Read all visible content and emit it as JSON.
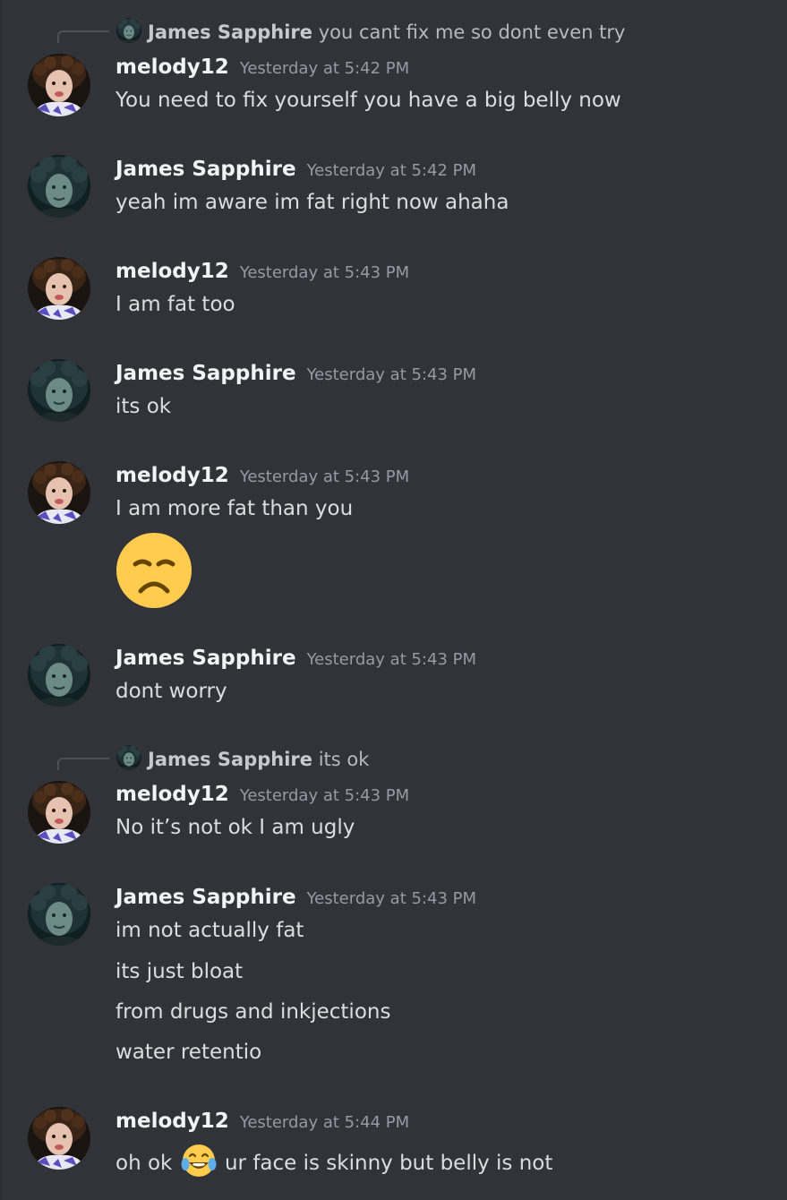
{
  "users": {
    "melody": "melody12",
    "james": "James Sapphire"
  },
  "messages": [
    {
      "reply": {
        "author": "James Sapphire",
        "content": "you cant fix me so dont even try"
      },
      "author": "melody12",
      "timestamp": "Yesterday at 5:42 PM",
      "lines": [
        "You need to fix yourself you have a big belly now"
      ]
    },
    {
      "author": "James Sapphire",
      "timestamp": "Yesterday at 5:42 PM",
      "lines": [
        "yeah im aware im fat right now ahaha"
      ]
    },
    {
      "author": "melody12",
      "timestamp": "Yesterday at 5:43 PM",
      "lines": [
        "I am fat too"
      ]
    },
    {
      "author": "James Sapphire",
      "timestamp": "Yesterday at 5:43 PM",
      "lines": [
        "its ok"
      ]
    },
    {
      "author": "melody12",
      "timestamp": "Yesterday at 5:43 PM",
      "lines": [
        "I am more fat than you"
      ],
      "emoji": "disappointed-face-emoji"
    },
    {
      "author": "James Sapphire",
      "timestamp": "Yesterday at 5:43 PM",
      "lines": [
        "dont worry"
      ]
    },
    {
      "reply": {
        "author": "James Sapphire",
        "content": "its ok"
      },
      "author": "melody12",
      "timestamp": "Yesterday at 5:43 PM",
      "lines": [
        "No it’s not ok I am ugly"
      ]
    },
    {
      "author": "James Sapphire",
      "timestamp": "Yesterday at 5:43 PM",
      "lines": [
        "im not actually fat",
        "its just bloat",
        "from drugs and inkjections",
        "water retentio"
      ]
    },
    {
      "author": "melody12",
      "timestamp": "Yesterday at 5:44 PM",
      "lines_parts": {
        "before": "oh ok",
        "emoji": "tears-of-joy-emoji",
        "after": "ur face is skinny but belly is not"
      }
    }
  ],
  "colors": {
    "background": "#313338",
    "author": "#f2f3f5",
    "text": "#dbdee1",
    "timestamp": "#949ba4"
  }
}
